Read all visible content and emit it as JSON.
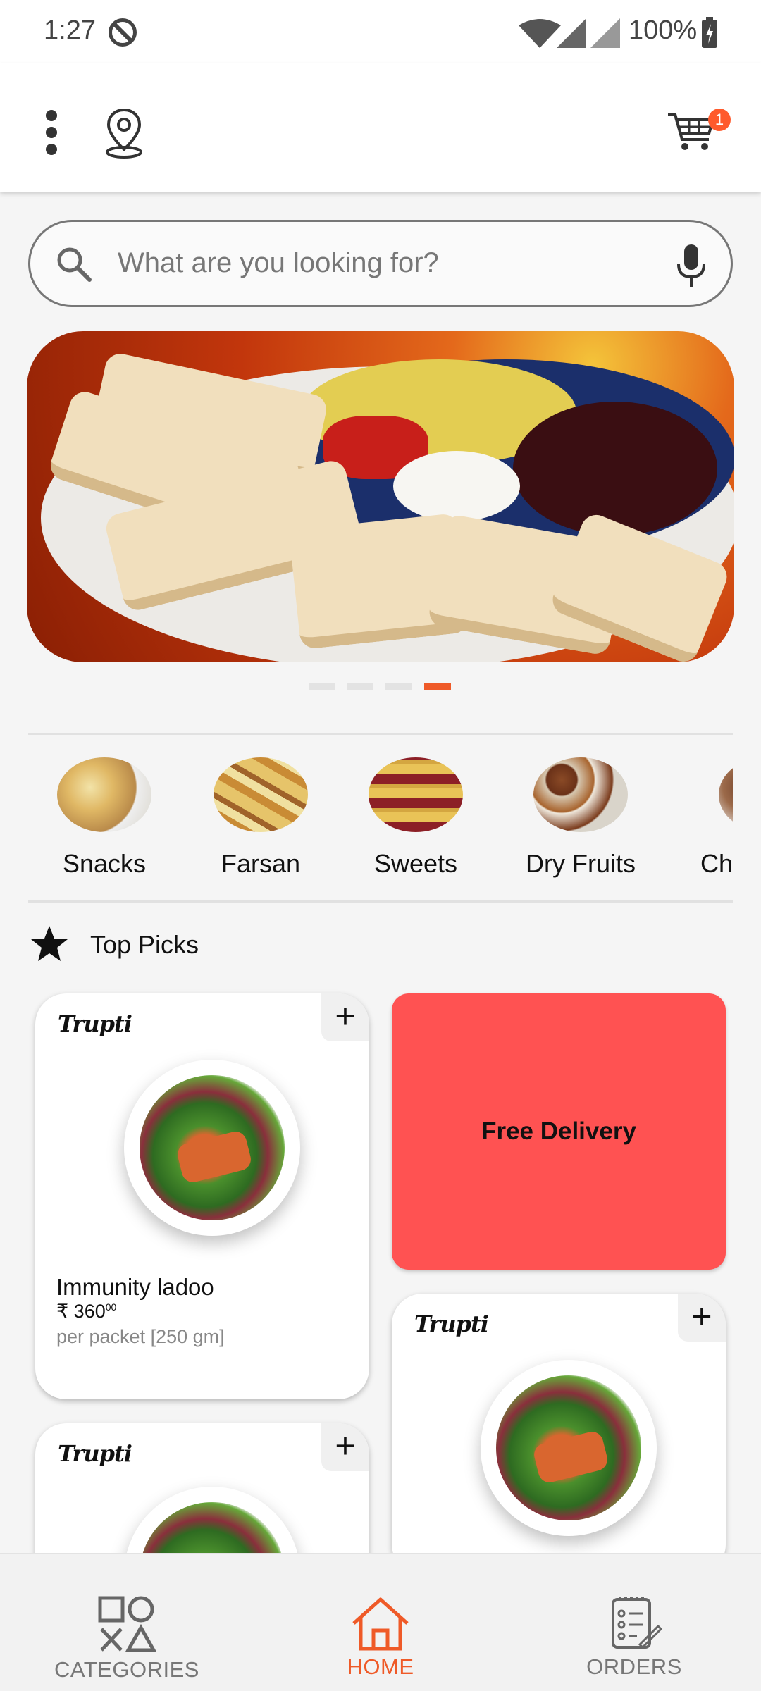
{
  "status_bar": {
    "time": "1:27",
    "battery": "100%"
  },
  "app_bar": {
    "cart_count": "1",
    "accent": "#ef5a28"
  },
  "search": {
    "placeholder": "What are you looking for?"
  },
  "banner": {
    "page_count": 4,
    "active_index": 3
  },
  "categories": [
    {
      "label": "Snacks"
    },
    {
      "label": "Farsan"
    },
    {
      "label": "Sweets"
    },
    {
      "label": "Dry Fruits"
    },
    {
      "label": "Ch"
    }
  ],
  "top_picks": {
    "title": "Top Picks",
    "products": [
      {
        "brand": "Trupti",
        "name": "Immunity ladoo",
        "price": "₹ 360",
        "price_fraction": "00",
        "unit": "per packet [250 gm]"
      },
      {
        "brand": "Trupti"
      },
      {
        "brand": "Trupti"
      }
    ],
    "promo": "Free Delivery"
  },
  "bottom_nav": {
    "categories": "CATEGORIES",
    "home": "HOME",
    "orders": "ORDERS",
    "active": "home"
  }
}
